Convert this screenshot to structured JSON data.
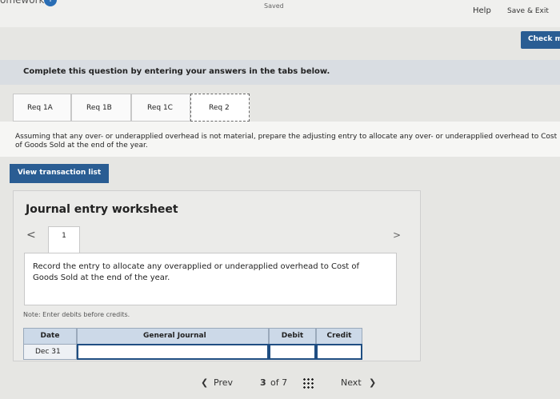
{
  "header": {
    "app_title": "omework",
    "saved": "Saved",
    "help": "Help",
    "save_exit": "Save & Exit",
    "check": "Check m",
    "info_glyph": "i"
  },
  "instruction": "Complete this question by entering your answers in the tabs below.",
  "tabs": [
    {
      "label": "Req 1A",
      "active": false
    },
    {
      "label": "Req 1B",
      "active": false
    },
    {
      "label": "Req 1C",
      "active": false
    },
    {
      "label": "Req 2",
      "active": true
    }
  ],
  "question": "Assuming that any over- or underapplied overhead is not material, prepare the adjusting entry to allocate any over- or underapplied overhead to Cost of Goods Sold at the end of the year.",
  "view_transactions": "View transaction list",
  "worksheet": {
    "title": "Journal entry worksheet",
    "nav_prev_glyph": "<",
    "nav_next_glyph": ">",
    "entry_number": "1",
    "record_text": "Record the entry to allocate any overapplied or underapplied overhead to Cost of Goods Sold at the end of the year.",
    "note": "Note: Enter debits before credits.",
    "columns": [
      "Date",
      "General Journal",
      "Debit",
      "Credit"
    ],
    "rows": [
      {
        "date": "Dec 31",
        "account": "",
        "debit": "",
        "credit": ""
      }
    ]
  },
  "pager": {
    "prev": "Prev",
    "prev_glyph": "❮",
    "current": "3",
    "of": "of 7",
    "next": "Next",
    "next_glyph": "❯"
  },
  "colors": {
    "accent": "#2a5d93",
    "table_header": "#ccd9e8"
  }
}
